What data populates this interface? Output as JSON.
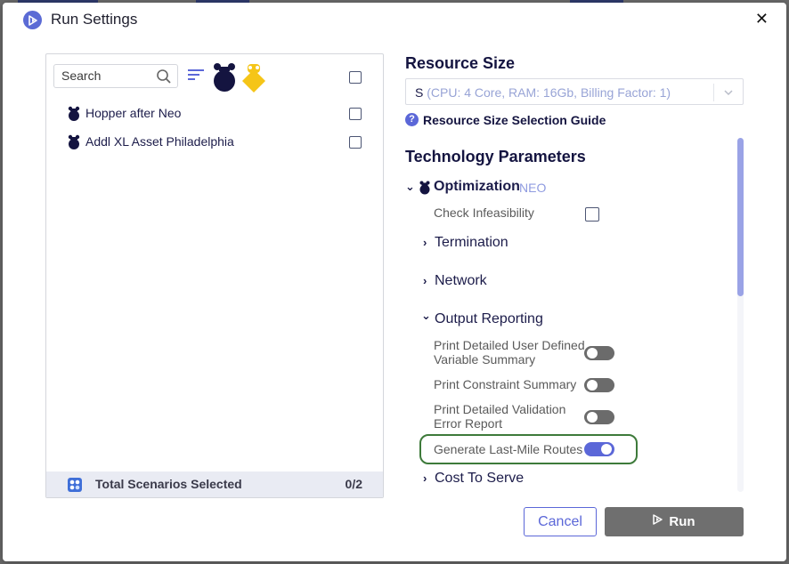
{
  "dialog": {
    "title": "Run Settings",
    "close_label": "✕"
  },
  "scenarios": {
    "search_placeholder": "Search",
    "items": [
      {
        "label": "Hopper after Neo",
        "icon": "neo-engine-icon"
      },
      {
        "label": "Addl XL Asset Philadelphia",
        "icon": "neo-engine-icon"
      }
    ],
    "footer_label": "Total Scenarios Selected",
    "footer_count": "0/2"
  },
  "resource": {
    "title": "Resource Size",
    "selected_value": "S",
    "selected_detail": "(CPU: 4 Core, RAM: 16Gb, Billing Factor: 1)",
    "guide_label": "Resource Size Selection Guide"
  },
  "tech": {
    "title": "Technology Parameters",
    "optimization_label": "Optimization",
    "optimization_tag": "NEO",
    "check_infeasibility": "Check Infeasibility",
    "groups": {
      "termination": "Termination",
      "network": "Network",
      "output_reporting": "Output Reporting",
      "cost_to_serve": "Cost To Serve"
    },
    "output_params": {
      "p1_line1": "Print Detailed User Defined",
      "p1_line2": "Variable Summary",
      "p2": "Print Constraint Summary",
      "p3_line1": "Print Detailed Validation",
      "p3_line2": "Error Report",
      "p4": "Generate Last-Mile Routes"
    },
    "toggles": {
      "p1": false,
      "p2": false,
      "p3": false,
      "p4": true
    }
  },
  "buttons": {
    "cancel": "Cancel",
    "run": "Run"
  },
  "colors": {
    "accent": "#5b67d8",
    "navy": "#141440",
    "gold": "#f5c518",
    "highlight_border": "#3d7a3a"
  }
}
